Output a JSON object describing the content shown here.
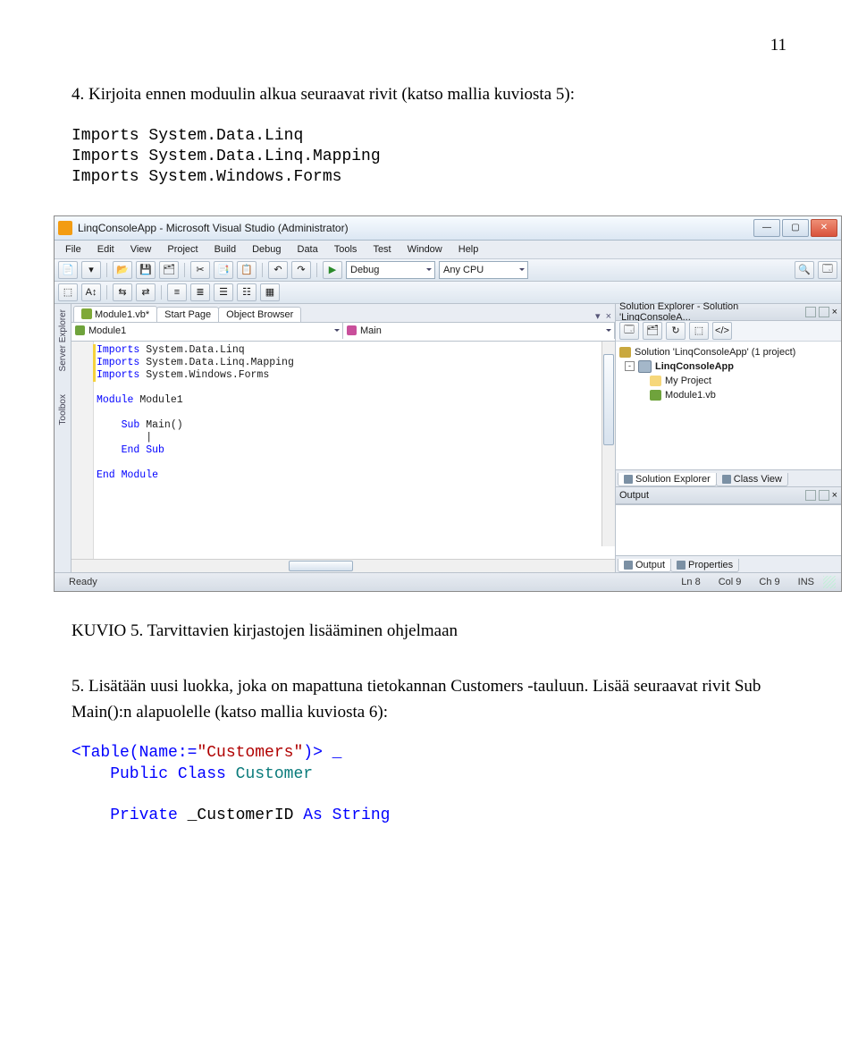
{
  "page_number": "11",
  "text": {
    "p1a": "4. Kirjoita ennen moduulin alkua seuraavat rivit (katso mallia kuviosta 5):",
    "code1": "Imports System.Data.Linq\nImports System.Data.Linq.Mapping\nImports System.Windows.Forms",
    "caption": "KUVIO 5. Tarvittavien kirjastojen lisääminen ohjelmaan",
    "p2": "5. Lisätään uusi luokka, joka on mapattuna tietokannan Customers -tauluun. Lisää seuraavat rivit Sub Main():n alapuolelle (katso mallia kuviosta 6):",
    "code2_l1a": "<Table(Name:=",
    "code2_l1b": "\"Customers\"",
    "code2_l1c": ")> _",
    "code2_l2": "    Public Class ",
    "code2_l2b": "Customer",
    "code2_l3": "    Private ",
    "code2_l3b": "_CustomerID ",
    "code2_l3c": "As String"
  },
  "vs": {
    "title": "LinqConsoleApp - Microsoft Visual Studio (Administrator)",
    "menu": [
      "File",
      "Edit",
      "View",
      "Project",
      "Build",
      "Debug",
      "Data",
      "Tools",
      "Test",
      "Window",
      "Help"
    ],
    "config": "Debug",
    "platform": "Any CPU",
    "tabs": {
      "active": "Module1.vb*",
      "others": [
        "Start Page",
        "Object Browser"
      ]
    },
    "objdrop_left": "Module1",
    "objdrop_right": "Main",
    "leftrail": "Server Explorer",
    "leftrail2": "Toolbox",
    "code_lines": [
      {
        "t": "Imports System.Data.Linq",
        "cls": "kw",
        "pre": ""
      },
      {
        "t": "Imports System.Data.Linq.Mapping",
        "cls": "kw",
        "pre": ""
      },
      {
        "t": "Imports System.Windows.Forms",
        "cls": "kw",
        "pre": ""
      },
      {
        "t": "",
        "cls": "",
        "pre": ""
      },
      {
        "t": "Module Module1",
        "cls": "",
        "pre": ""
      },
      {
        "t": "",
        "cls": "",
        "pre": ""
      },
      {
        "t": "Sub Main()",
        "cls": "",
        "pre": "    ",
        "kw1": "Sub"
      },
      {
        "t": "",
        "cls": "",
        "pre": "        "
      },
      {
        "t": "End Sub",
        "cls": "",
        "pre": "    ",
        "kw1": "End Sub"
      },
      {
        "t": "",
        "cls": "",
        "pre": ""
      },
      {
        "t": "End Module",
        "cls": "",
        "pre": "",
        "kw1": "End Module"
      }
    ],
    "solexp": {
      "title": "Solution Explorer - Solution 'LinqConsoleA...",
      "sol": "Solution 'LinqConsoleApp' (1 project)",
      "proj": "LinqConsoleApp",
      "items": [
        "My Project",
        "Module1.vb"
      ],
      "tabs": [
        "Solution Explorer",
        "Class View"
      ]
    },
    "output": {
      "title": "Output",
      "tabs": [
        "Output",
        "Properties"
      ]
    },
    "status": {
      "ready": "Ready",
      "ln": "Ln 8",
      "col": "Col 9",
      "ch": "Ch 9",
      "ins": "INS"
    }
  }
}
